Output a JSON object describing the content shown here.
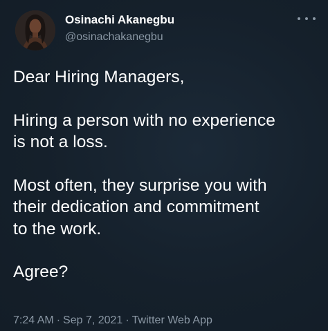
{
  "author": {
    "name": "Osinachi Akanegbu",
    "handle": "@osinachakanegbu"
  },
  "tweet": {
    "paragraphs": [
      [
        "Dear Hiring Managers,"
      ],
      [
        "Hiring a person with no experience",
        "is not a loss."
      ],
      [
        "Most often, they surprise you with",
        "their dedication and commitment",
        "to the work."
      ],
      [
        "Agree?"
      ]
    ]
  },
  "meta": {
    "time": "7:24 AM",
    "separator": "·",
    "date": "Sep 7, 2021",
    "source": "Twitter Web App"
  },
  "icons": {
    "more": "more-dots-icon",
    "avatar": "profile-photo"
  },
  "colors": {
    "background": "#15202b",
    "text": "#ffffff",
    "secondary": "#8b98a5"
  }
}
